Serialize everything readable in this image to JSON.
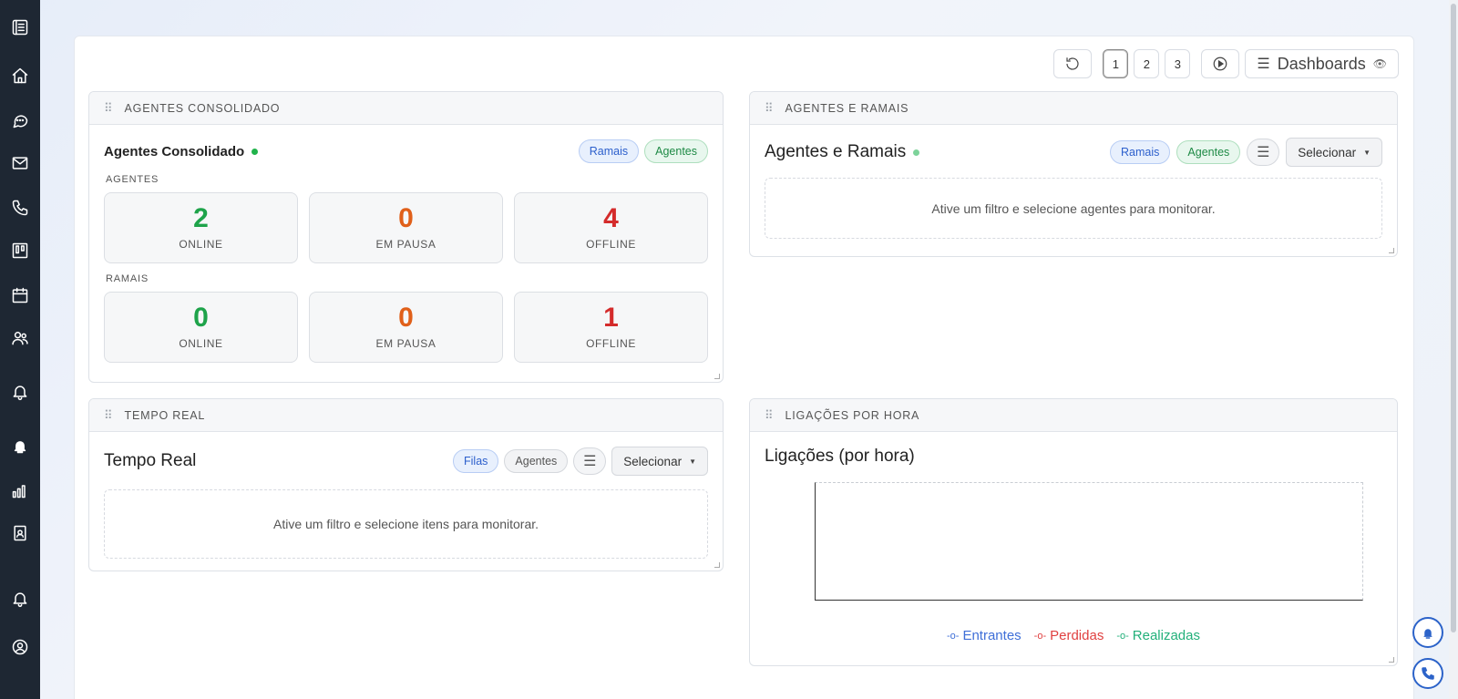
{
  "sidebar": {
    "items": [
      {
        "icon": "list-icon"
      },
      {
        "icon": "home-icon"
      },
      {
        "icon": "chat-icon"
      },
      {
        "icon": "mail-icon"
      },
      {
        "icon": "phone-icon"
      },
      {
        "icon": "kanban-icon"
      },
      {
        "icon": "calendar-icon"
      },
      {
        "icon": "users-icon"
      },
      {
        "icon": "bell-icon"
      },
      {
        "icon": "notify-bell-icon"
      },
      {
        "icon": "bar-chart-icon"
      },
      {
        "icon": "contact-card-icon"
      },
      {
        "icon": "bell-icon"
      },
      {
        "icon": "user-circle-icon"
      }
    ]
  },
  "toolbar": {
    "pages": [
      "1",
      "2",
      "3"
    ],
    "active_page": "1",
    "dashboards_label": "Dashboards"
  },
  "panels": {
    "agentes_consolidado": {
      "header": "AGENTES CONSOLIDADO",
      "title": "Agentes Consolidado",
      "pill_ramais": "Ramais",
      "pill_agentes": "Agentes",
      "section_agentes": "AGENTES",
      "section_ramais": "RAMAIS",
      "agentes_stats": [
        {
          "value": "2",
          "label": "ONLINE"
        },
        {
          "value": "0",
          "label": "EM PAUSA"
        },
        {
          "value": "4",
          "label": "OFFLINE"
        }
      ],
      "ramais_stats": [
        {
          "value": "0",
          "label": "ONLINE"
        },
        {
          "value": "0",
          "label": "EM PAUSA"
        },
        {
          "value": "1",
          "label": "OFFLINE"
        }
      ]
    },
    "agentes_ramais": {
      "header": "AGENTES E RAMAIS",
      "title": "Agentes e Ramais",
      "pill_ramais": "Ramais",
      "pill_agentes": "Agentes",
      "select_label": "Selecionar",
      "empty_text": "Ative um filtro e selecione agentes para monitorar."
    },
    "tempo_real": {
      "header": "TEMPO REAL",
      "title": "Tempo Real",
      "pill_filas": "Filas",
      "pill_agentes": "Agentes",
      "select_label": "Selecionar",
      "empty_text": "Ative um filtro e selecione itens para monitorar."
    },
    "ligacoes": {
      "header": "LIGAÇÕES POR HORA",
      "title": "Ligações (por hora)",
      "legend": [
        {
          "name": "Entrantes",
          "color": "#3f6fd8"
        },
        {
          "name": "Perdidas",
          "color": "#e04040"
        },
        {
          "name": "Realizadas",
          "color": "#22b07a"
        }
      ]
    }
  },
  "colors": {
    "sidebar_bg": "#1e2733",
    "online": "#1ea34a",
    "pause": "#e0601a",
    "offline": "#d42b2b"
  }
}
